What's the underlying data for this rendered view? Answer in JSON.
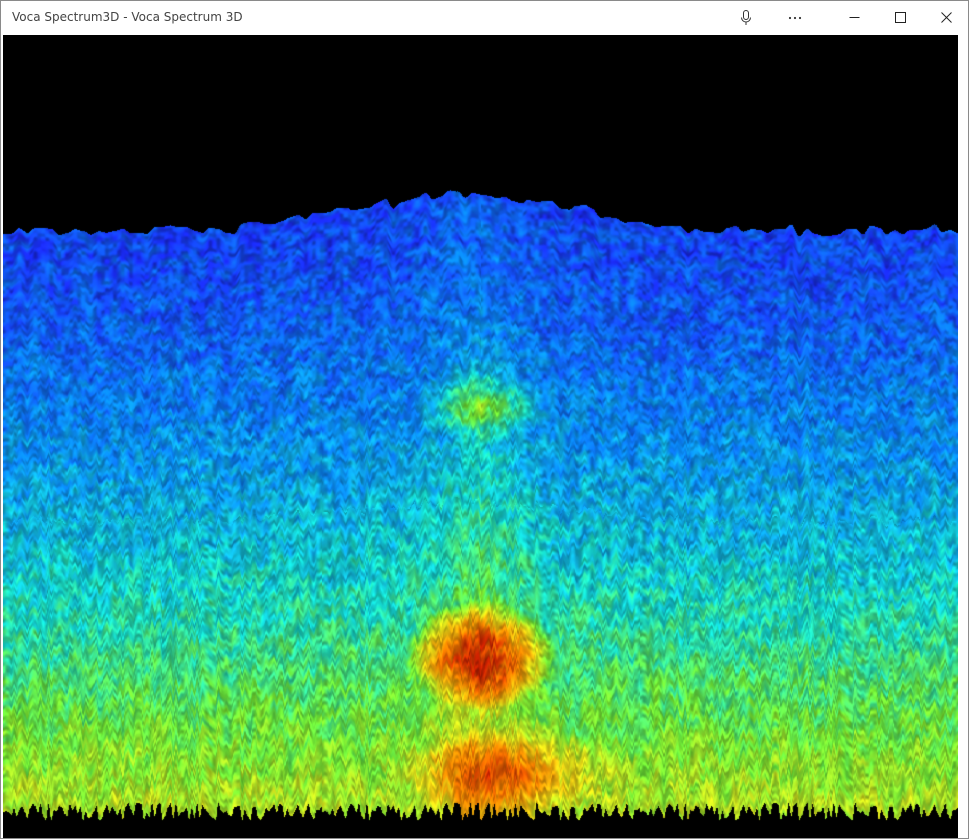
{
  "window": {
    "title": "Voca Spectrum3D - Voca Spectrum 3D"
  },
  "titlebar_buttons": [
    {
      "name": "microphone-icon",
      "label": "microphone"
    },
    {
      "name": "more-options-icon",
      "label": "more"
    },
    {
      "name": "minimize-icon",
      "label": "minimize"
    },
    {
      "name": "maximize-icon",
      "label": "maximize"
    },
    {
      "name": "close-icon",
      "label": "close"
    }
  ],
  "view": {
    "description_colormap": "jet",
    "background": "#000000",
    "colormap_stops": [
      "#1b2dff",
      "#0a8cff",
      "#16e0d2",
      "#74f43a",
      "#e8e71a",
      "#ff8c00",
      "#cc2200"
    ]
  }
}
